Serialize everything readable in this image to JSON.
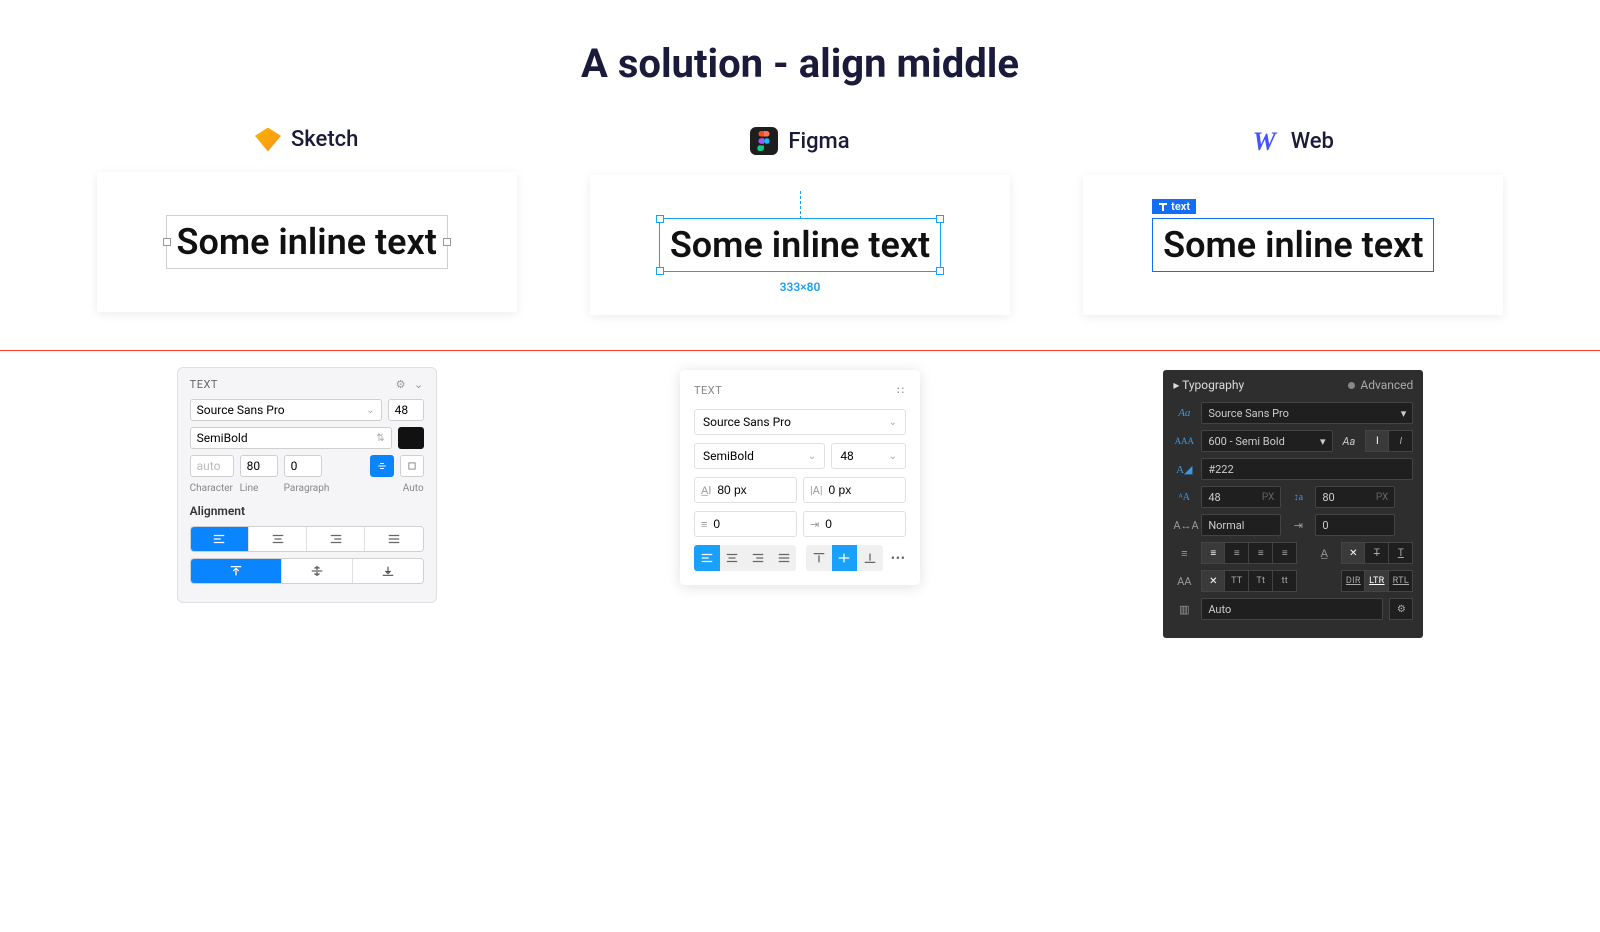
{
  "title": "A solution - align middle",
  "columns": {
    "sketch": {
      "label": "Sketch"
    },
    "figma": {
      "label": "Figma",
      "dims": "333×80"
    },
    "web": {
      "label": "Web",
      "tag": "text"
    }
  },
  "sample_text": "Some inline text",
  "sketch_panel": {
    "section": "TEXT",
    "font": "Source Sans Pro",
    "size": "48",
    "weight": "SemiBold",
    "character": "auto",
    "line": "80",
    "paragraph": "0",
    "labels": {
      "character": "Character",
      "line": "Line",
      "paragraph": "Paragraph",
      "auto": "Auto"
    },
    "alignment_label": "Alignment"
  },
  "figma_panel": {
    "section": "TEXT",
    "font": "Source Sans Pro",
    "weight": "SemiBold",
    "size": "48",
    "line_height": "80 px",
    "letter_spacing": "0 px",
    "para_spacing": "0",
    "para_indent": "0"
  },
  "web_panel": {
    "title": "Typography",
    "mode": "Advanced",
    "font": "Source Sans Pro",
    "weight": "600 - Semi Bold",
    "color": "#222",
    "size": "48",
    "line": "80",
    "letter": "Normal",
    "indent": "0",
    "auto": "Auto",
    "unit": "PX"
  }
}
